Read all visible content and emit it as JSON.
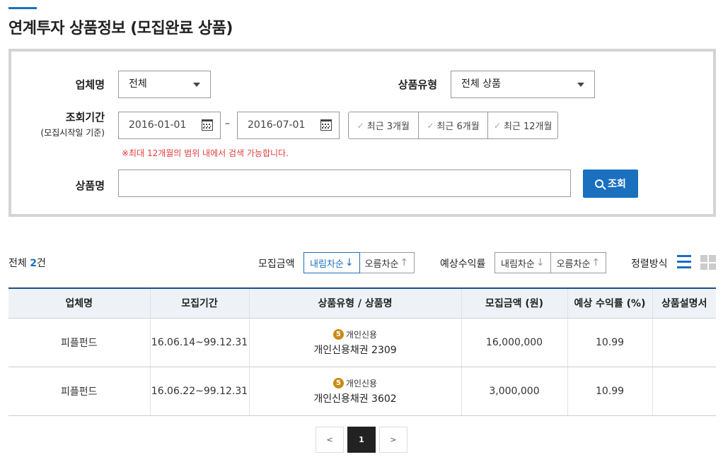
{
  "page": {
    "title": "연계투자 상품정보 (모집완료 상품)"
  },
  "filters": {
    "company_label": "업체명",
    "company_value": "전체",
    "type_label": "상품유형",
    "type_value": "전체 상품",
    "period_label": "조회기간",
    "period_sublabel": "(모집시작일 기준)",
    "start_date": "2016-01-01",
    "end_date": "2016-07-01",
    "dash": "–",
    "quick_periods": [
      "최근 3개월",
      "최근 6개월",
      "최근 12개월"
    ],
    "warning": "※최대 12개월의 범위 내에서 검색 가능합니다.",
    "name_label": "상품명",
    "name_value": "",
    "search_button": "조회"
  },
  "results": {
    "total_prefix": "전체",
    "total_count": "2",
    "total_suffix": "건",
    "amount_sort_label": "모집금액",
    "return_sort_label": "예상수익률",
    "desc_label": "내림차순",
    "asc_label": "오름차순",
    "view_label": "정렬방식"
  },
  "table": {
    "headers": [
      "업체명",
      "모집기간",
      "상품유형 / 상품명",
      "모집금액 (원)",
      "예상 수익률 (%)",
      "상품설명서"
    ],
    "rows": [
      {
        "company": "피플펀드",
        "period": "16.06.14~99.12.31",
        "grade": "5",
        "type": "개인신용",
        "name": "개인신용채권 2309",
        "amount": "16,000,000",
        "rate": "10.99",
        "doc": ""
      },
      {
        "company": "피플펀드",
        "period": "16.06.22~99.12.31",
        "grade": "5",
        "type": "개인신용",
        "name": "개인신용채권 3602",
        "amount": "3,000,000",
        "rate": "10.99",
        "doc": ""
      }
    ]
  },
  "pagination": {
    "prev": "<",
    "current": "1",
    "next": ">"
  },
  "colors": {
    "accent": "#1a6fbf",
    "warning": "#e03c3c",
    "grade_badge": "#c98a12"
  }
}
